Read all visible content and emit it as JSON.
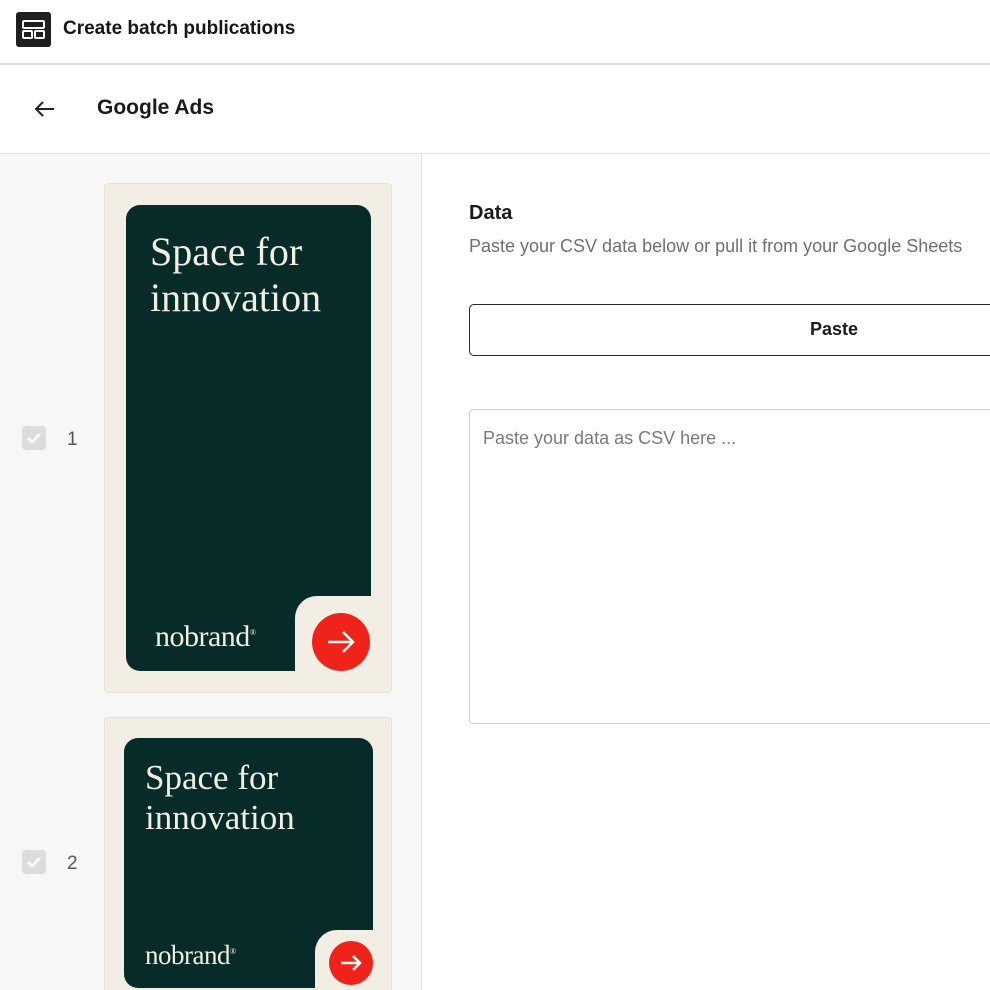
{
  "app": {
    "title": "Create batch publications",
    "icon": "layout-icon"
  },
  "header": {
    "back_icon": "arrow-left-icon",
    "title": "Google Ads"
  },
  "publications": [
    {
      "index": "1",
      "checked": true,
      "headline_line1": "Space for",
      "headline_line2": "innovation",
      "brand": "nobrand",
      "brand_mark": "®"
    },
    {
      "index": "2",
      "checked": true,
      "headline_line1": "Space for",
      "headline_line2": "innovation",
      "brand": "nobrand",
      "brand_mark": "®"
    }
  ],
  "data_section": {
    "title": "Data",
    "description": "Paste your CSV data below or pull it from your Google Sheets",
    "paste_label": "Paste",
    "placeholder": "Paste your data as CSV here ..."
  },
  "colors": {
    "ad_dark": "#062b28",
    "ad_cream": "#f3eee4",
    "cta_red": "#f0231b"
  }
}
